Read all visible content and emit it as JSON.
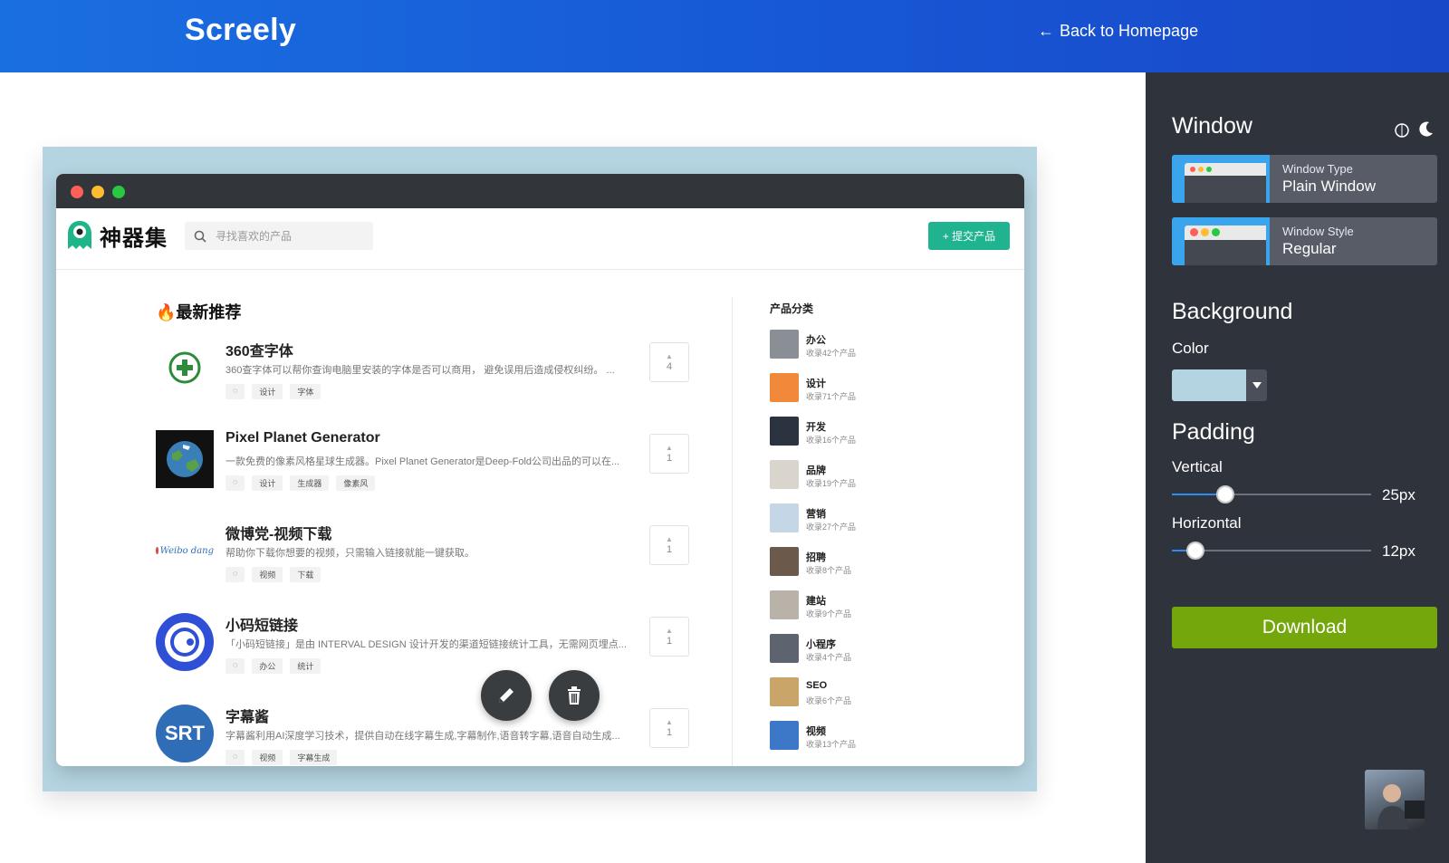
{
  "topbar": {
    "brand": "Screely",
    "back_label": "Back to Homepage",
    "back_arrow": "←"
  },
  "preview": {
    "background_color": "#b5d4e1",
    "site": {
      "logo_text": "神器集",
      "search_placeholder": "寻找喜欢的产品",
      "submit_label": "+ 提交产品",
      "feed_title": "🔥最新推荐",
      "items": [
        {
          "name": "360查字体",
          "desc": "360查字体可以帮你查询电脑里安装的字体是否可以商用， 避免误用后造成侵权纠纷。 ...",
          "tags": [
            "设计",
            "字体"
          ],
          "votes": "4"
        },
        {
          "name": "Pixel Planet Generator",
          "desc": "一款免费的像素风格星球生成器。Pixel Planet Generator是Deep-Fold公司出品的可以在...",
          "tags": [
            "设计",
            "生成器",
            "像素风"
          ],
          "votes": "1"
        },
        {
          "name": "微博党-视频下载",
          "desc": "帮助你下载你想要的视频，只需输入链接就能一键获取。",
          "tags": [
            "视频",
            "下载"
          ],
          "votes": "1",
          "logo_text": "Weibo dang"
        },
        {
          "name": "小码短链接",
          "desc": "「小码短链接」是由 INTERVAL DESIGN 设计开发的渠道短链接统计工具，无需网页埋点...",
          "tags": [
            "办公",
            "统计"
          ],
          "votes": "1"
        },
        {
          "name": "字幕酱",
          "desc": "字幕酱利用AI深度学习技术，提供自动在线字幕生成,字幕制作,语音转字幕,语音自动生成...",
          "tags": [
            "视频",
            "字幕生成"
          ],
          "votes": "1",
          "logo_text": "SRT"
        }
      ],
      "categories_title": "产品分类",
      "categories": [
        {
          "name": "办公",
          "count": "收录42个产品",
          "color": "#8a8f96"
        },
        {
          "name": "设计",
          "count": "收录71个产品",
          "color": "#f0893a"
        },
        {
          "name": "开发",
          "count": "收录16个产品",
          "color": "#2b3240"
        },
        {
          "name": "品牌",
          "count": "收录19个产品",
          "color": "#d9d4cc"
        },
        {
          "name": "营销",
          "count": "收录27个产品",
          "color": "#c5d6e6"
        },
        {
          "name": "招聘",
          "count": "收录8个产品",
          "color": "#6b5a4c"
        },
        {
          "name": "建站",
          "count": "收录9个产品",
          "color": "#b8b2a8"
        },
        {
          "name": "小程序",
          "count": "收录4个产品",
          "color": "#5d6470"
        },
        {
          "name": "SEO",
          "count": "收录6个产品",
          "color": "#c9a56a"
        },
        {
          "name": "视频",
          "count": "收录13个产品",
          "color": "#3d78c8"
        }
      ]
    }
  },
  "panel": {
    "window_heading": "Window",
    "window_type_label": "Window Type",
    "window_type_value": "Plain Window",
    "window_style_label": "Window Style",
    "window_style_value": "Regular",
    "background_heading": "Background",
    "color_label": "Color",
    "color_value": "#b5d4e1",
    "padding_heading": "Padding",
    "vertical_label": "Vertical",
    "vertical_value": "25px",
    "vertical_fraction": 0.27,
    "horizontal_label": "Horizontal",
    "horizontal_value": "12px",
    "horizontal_fraction": 0.12,
    "download_label": "Download",
    "accent_color": "#74a70b"
  }
}
